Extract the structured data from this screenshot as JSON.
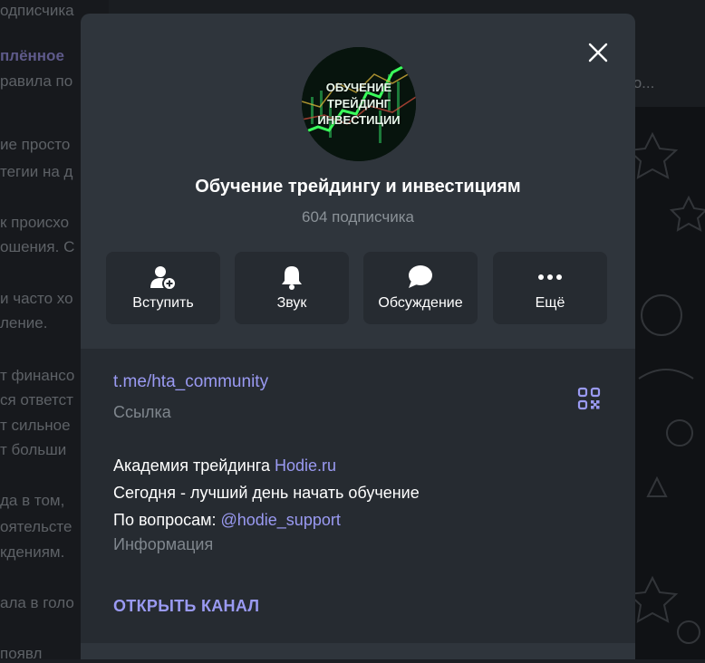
{
  "background": {
    "left_lines": [
      "одписчика",
      "плённое",
      "равила по",
      "ие просто",
      "тегии на д",
      "к происхо",
      "ошения. С",
      "и часто хо",
      "ление.",
      "т финансо",
      "ся ответст",
      "т сильное",
      "т больши",
      "да в том,",
      "оятельсте",
      "кдениям.",
      "ала в голо",
      "появл"
    ],
    "header_text": "со..."
  },
  "modal": {
    "avatar_text": [
      "ОБУЧЕНИЕ",
      "ТРЕЙДИНГ",
      "ИНВЕСТИЦИИ"
    ],
    "title": "Обучение трейдингу и инвестициям",
    "subtitle": "604 подписчика",
    "actions": [
      {
        "label": "Вступить",
        "icon": "add-user-icon"
      },
      {
        "label": "Звук",
        "icon": "bell-icon"
      },
      {
        "label": "Обсуждение",
        "icon": "chat-bubble-icon"
      },
      {
        "label": "Ещё",
        "icon": "more-dots-icon"
      }
    ],
    "info": {
      "link": "t.me/hta_community",
      "link_caption": "Ссылка",
      "description": {
        "line1_prefix": "Академия трейдинга ",
        "line1_link": "Hodie.ru",
        "line2": "Сегодня - лучший день начать обучение",
        "line3_prefix": "По вопросам: ",
        "line3_link": "@hodie_support"
      },
      "description_caption": "Информация",
      "open_button": "ОТКРЫТЬ КАНАЛ"
    }
  },
  "colors": {
    "accent": "#9a9af2",
    "modal_bg": "#2f353c",
    "panel_bg": "#262b31"
  }
}
